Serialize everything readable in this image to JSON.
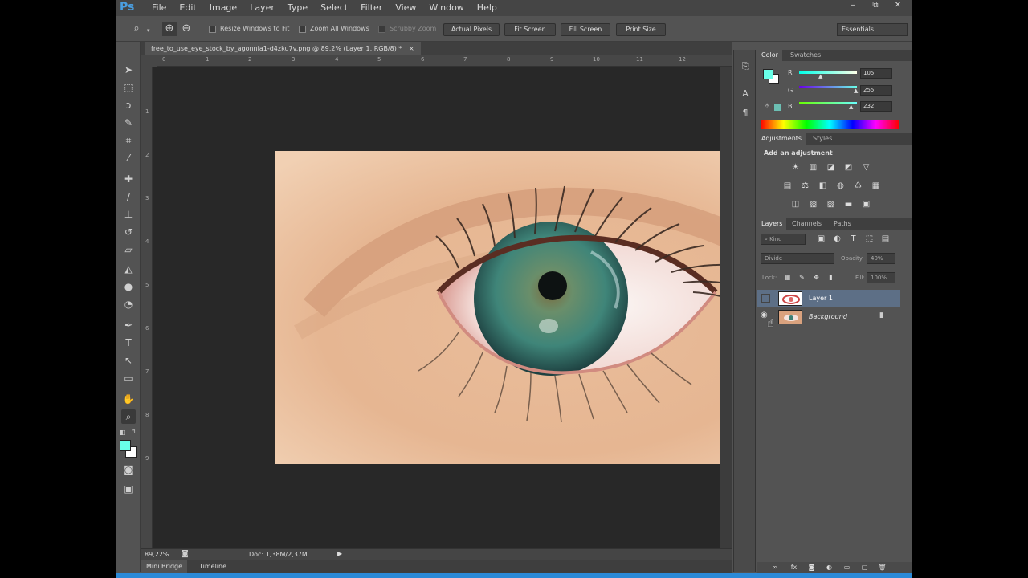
{
  "app": {
    "logo": "Ps"
  },
  "menu": [
    "File",
    "Edit",
    "Image",
    "Layer",
    "Type",
    "Select",
    "Filter",
    "View",
    "Window",
    "Help"
  ],
  "window_controls": [
    "–",
    "⧉",
    "✕"
  ],
  "options_bar": {
    "resize_windows": "Resize Windows to Fit",
    "zoom_all": "Zoom All Windows",
    "scrubby_zoom": "Scrubby Zoom",
    "actual_pixels": "Actual Pixels",
    "fit_screen": "Fit Screen",
    "fill_screen": "Fill Screen",
    "print_size": "Print Size",
    "workspace": "Essentials"
  },
  "document": {
    "tab_title": "free_to_use_eye_stock_by_agonnia1-d4zku7v.png @ 89,2% (Layer 1, RGB/8) *",
    "ruler_h": [
      "0",
      "1",
      "2",
      "3",
      "4",
      "5",
      "6",
      "7",
      "8",
      "9",
      "10",
      "11",
      "12"
    ],
    "ruler_v": [
      "1",
      "2",
      "3",
      "4",
      "5",
      "6",
      "7",
      "8",
      "9"
    ],
    "zoom": "89,22%",
    "doc_info": "Doc: 1,38M/2,37M"
  },
  "bottom_tabs": [
    "Mini Bridge",
    "Timeline"
  ],
  "color_panel": {
    "tabs": [
      "Color",
      "Swatches"
    ],
    "channels": [
      {
        "label": "R",
        "value": "105"
      },
      {
        "label": "G",
        "value": "255"
      },
      {
        "label": "B",
        "value": "232"
      }
    ],
    "foreground": "#69ffe8"
  },
  "adjustments_panel": {
    "tabs": [
      "Adjustments",
      "Styles"
    ],
    "heading": "Add an adjustment"
  },
  "layers_panel": {
    "tabs": [
      "Layers",
      "Channels",
      "Paths"
    ],
    "filter_kind": "Kind",
    "blend_mode": "Divide",
    "opacity_label": "Opacity:",
    "opacity_value": "40%",
    "lock_label": "Lock:",
    "fill_label": "Fill:",
    "fill_value": "100%",
    "layers": [
      {
        "name": "Layer 1",
        "selected": true
      },
      {
        "name": "Background",
        "selected": false,
        "locked": true
      }
    ]
  }
}
